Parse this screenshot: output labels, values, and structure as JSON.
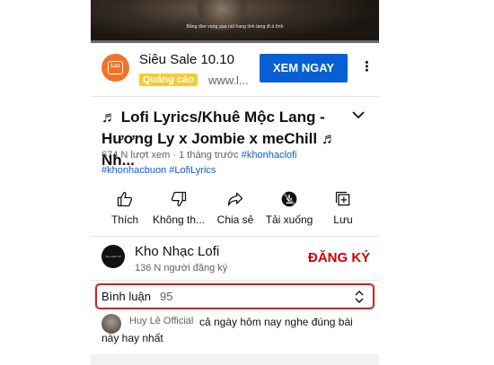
{
  "video": {
    "subtitle": "Bằng đàn vọng qua núi hang linh tang đi à tình",
    "progress": 0.0
  },
  "ad": {
    "logo_text": "Laz",
    "title": "Siêu Sale 10.10",
    "badge": "Quảng cáo",
    "url": "www.l...",
    "cta": "XEM NGAY",
    "more_icon": "⋮",
    "colors": {
      "cta": "#065fd4",
      "badge": "#f9c933",
      "logo": "#f57224"
    }
  },
  "video_info": {
    "title": "♬ Lofi Lyrics/Khuê Mộc Lang - Hương Ly x Jombie x meChill ♬ Nh...",
    "views": "674 N lượt xem",
    "separator": " · ",
    "age": "1 tháng trước",
    "tag1": "#khonhaclofi",
    "tags2": "#khonhacbuon #LofiLyrics"
  },
  "actions": [
    {
      "label": "Thích",
      "icon": "like-icon"
    },
    {
      "label": "Không th...",
      "icon": "dislike-icon"
    },
    {
      "label": "Chia sẻ",
      "icon": "share-icon"
    },
    {
      "label": "Tải xuống",
      "icon": "download-icon"
    },
    {
      "label": "Lưu",
      "icon": "save-to-playlist-icon"
    }
  ],
  "channel": {
    "name": "Kho Nhạc Lofi",
    "subscribers": "136 N người đăng ký",
    "subscribe": "ĐĂNG KÝ",
    "avatar_text": "kho nhac lofi",
    "colors": {
      "subscribe": "#cc0000"
    }
  },
  "comments": {
    "label": "Bình luận",
    "count": "95",
    "highlight_color": "#d11e1e",
    "first": {
      "author": "Huy Lê Official",
      "text_line1": "cả ngày hôm nay nghe đúng bài",
      "text_line2": "này hay nhất"
    }
  }
}
